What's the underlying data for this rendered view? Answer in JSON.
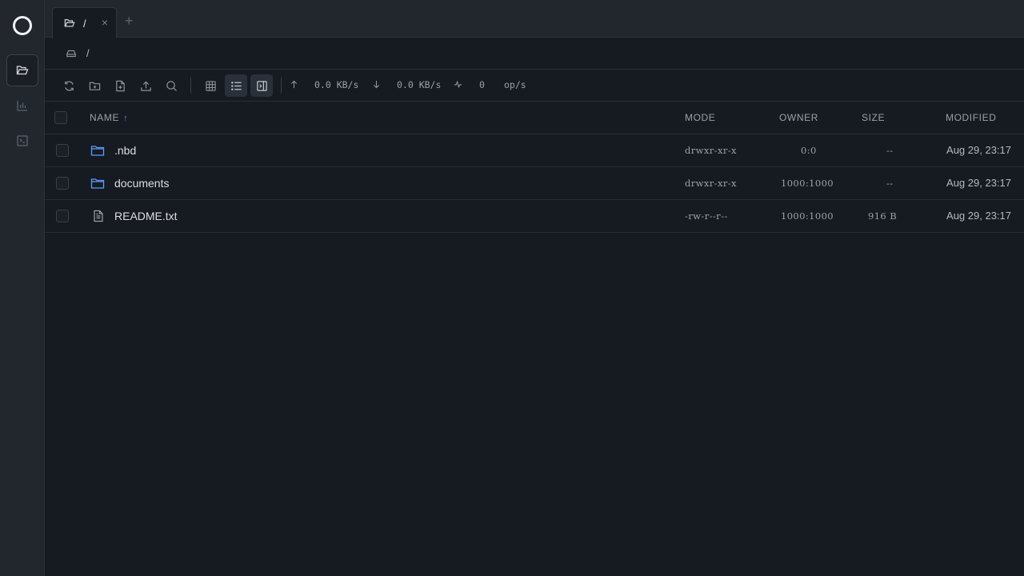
{
  "tab": {
    "label": "/",
    "close": "×",
    "add": "+"
  },
  "breadcrumb": {
    "path": "/"
  },
  "toolbar": {
    "upload_rate": "0.0 KB/s",
    "download_rate": "0.0 KB/s",
    "ops_count": "0",
    "ops_unit": "op/s"
  },
  "table": {
    "headers": {
      "name": "NAME",
      "mode": "MODE",
      "owner": "OWNER",
      "size": "SIZE",
      "modified": "MODIFIED"
    },
    "sort_indicator": "↑",
    "rows": [
      {
        "name": ".nbd",
        "type": "folder",
        "mode": "drwxr-xr-x",
        "owner": "0:0",
        "size": "--",
        "modified": "Aug 29, 23:17"
      },
      {
        "name": "documents",
        "type": "folder",
        "mode": "drwxr-xr-x",
        "owner": "1000:1000",
        "size": "--",
        "modified": "Aug 29, 23:17"
      },
      {
        "name": "README.txt",
        "type": "file",
        "mode": "-rw-r--r--",
        "owner": "1000:1000",
        "size": "916 B",
        "modified": "Aug 29, 23:17"
      }
    ]
  },
  "colors": {
    "folder_icon": "#5b9cf5",
    "accent": "#5b8def"
  }
}
